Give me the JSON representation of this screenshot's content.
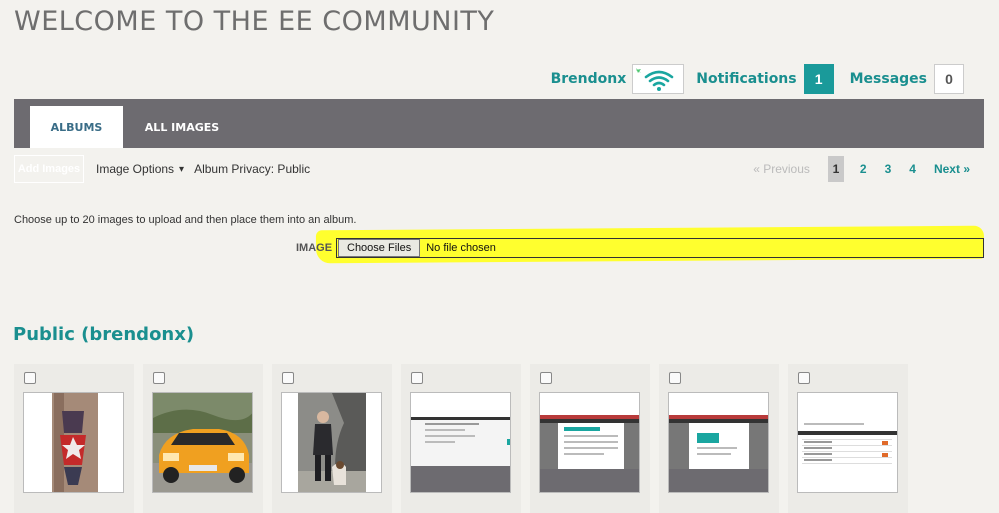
{
  "header": {
    "title": "WELCOME TO THE EE COMMUNITY"
  },
  "userbar": {
    "username": "Brendonx",
    "notifications_label": "Notifications",
    "notifications_count": "1",
    "messages_label": "Messages",
    "messages_count": "0"
  },
  "tabs": [
    {
      "label": "ALBUMS"
    },
    {
      "label": "ALL IMAGES"
    }
  ],
  "toolbar": {
    "add_images": "Add Images",
    "image_options": "Image Options",
    "album_privacy": "Album Privacy: Public"
  },
  "pager": {
    "previous": "« Previous",
    "pages": [
      "1",
      "2",
      "3",
      "4"
    ],
    "next": "Next »"
  },
  "upload": {
    "instructions": "Choose up to 20 images to upload and then place them into an album.",
    "field_label": "IMAGE",
    "choose_button": "Choose Files",
    "status": "No file chosen"
  },
  "album": {
    "title": "Public (brendonx)"
  },
  "colors": {
    "accent": "#1a8f8f",
    "tabbar": "#6d6b70",
    "highlight": "#ffff2e"
  }
}
